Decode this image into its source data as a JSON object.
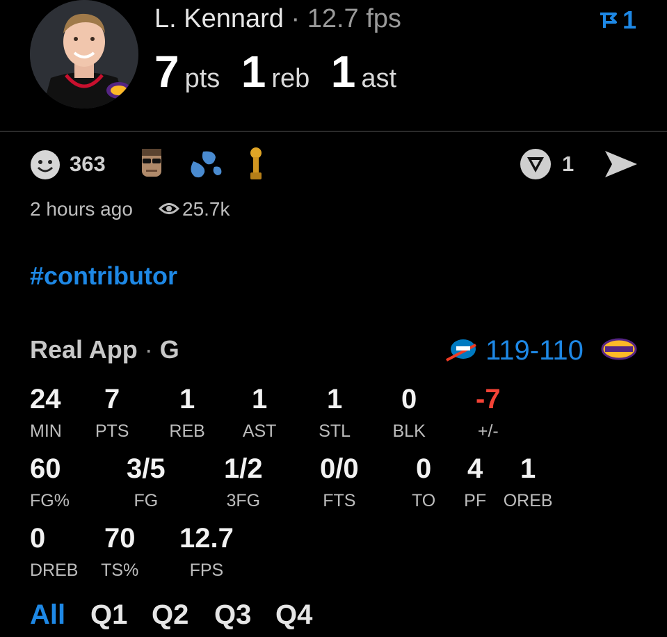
{
  "header": {
    "player_name": "L. Kennard",
    "separator": "·",
    "fps": "12.7 fps",
    "pts": "7",
    "pts_unit": "pts",
    "reb": "1",
    "reb_unit": "reb",
    "ast": "1",
    "ast_unit": "ast",
    "flag_count": "1"
  },
  "actions": {
    "reaction_count": "363",
    "boost_count": "1",
    "time_ago": "2 hours ago",
    "views": "25.7k"
  },
  "hashtag": "#contributor",
  "game": {
    "source": "Real App",
    "separator": "·",
    "position": "G",
    "score_left": "119",
    "score_sep": "-",
    "score_right": "110"
  },
  "stats": {
    "row1": [
      {
        "value": "24",
        "label": "MIN"
      },
      {
        "value": "7",
        "label": "PTS"
      },
      {
        "value": "1",
        "label": "REB"
      },
      {
        "value": "1",
        "label": "AST"
      },
      {
        "value": "1",
        "label": "STL"
      },
      {
        "value": "0",
        "label": "BLK"
      },
      {
        "value": "-7",
        "label": "+/-"
      }
    ],
    "row2": [
      {
        "value": "60",
        "label": "FG%"
      },
      {
        "value": "3/5",
        "label": "FG"
      },
      {
        "value": "1/2",
        "label": "3FG"
      },
      {
        "value": "0/0",
        "label": "FTS"
      },
      {
        "value": "0",
        "label": "TO"
      },
      {
        "value": "4",
        "label": "PF"
      },
      {
        "value": "1",
        "label": "OREB"
      }
    ],
    "row3": [
      {
        "value": "0",
        "label": "DREB"
      },
      {
        "value": "70",
        "label": "TS%"
      },
      {
        "value": "12.7",
        "label": "FPS"
      }
    ]
  },
  "tabs": [
    "All",
    "Q1",
    "Q2",
    "Q3",
    "Q4"
  ],
  "colors": {
    "accent": "#1e88e5",
    "negative": "#f44336",
    "background": "#000000"
  }
}
